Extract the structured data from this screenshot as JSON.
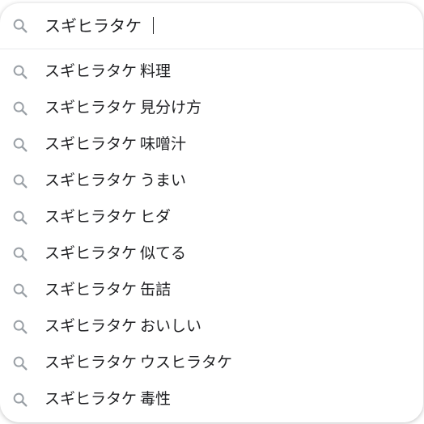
{
  "search": {
    "query": "スギヒラタケ",
    "icon": "search-icon"
  },
  "colors": {
    "icon": "#9aa0a6",
    "text": "#202124",
    "divider": "#e8eaed"
  },
  "suggestions": [
    {
      "base": "スギヒラタケ",
      "completion": "料理"
    },
    {
      "base": "スギヒラタケ",
      "completion": "見分け方"
    },
    {
      "base": "スギヒラタケ",
      "completion": "味噌汁"
    },
    {
      "base": "スギヒラタケ",
      "completion": "うまい"
    },
    {
      "base": "スギヒラタケ",
      "completion": "ヒダ"
    },
    {
      "base": "スギヒラタケ",
      "completion": "似てる"
    },
    {
      "base": "スギヒラタケ",
      "completion": "缶詰"
    },
    {
      "base": "スギヒラタケ",
      "completion": "おいしい"
    },
    {
      "base": "スギヒラタケ",
      "completion": "ウスヒラタケ"
    },
    {
      "base": "スギヒラタケ",
      "completion": "毒性"
    }
  ]
}
